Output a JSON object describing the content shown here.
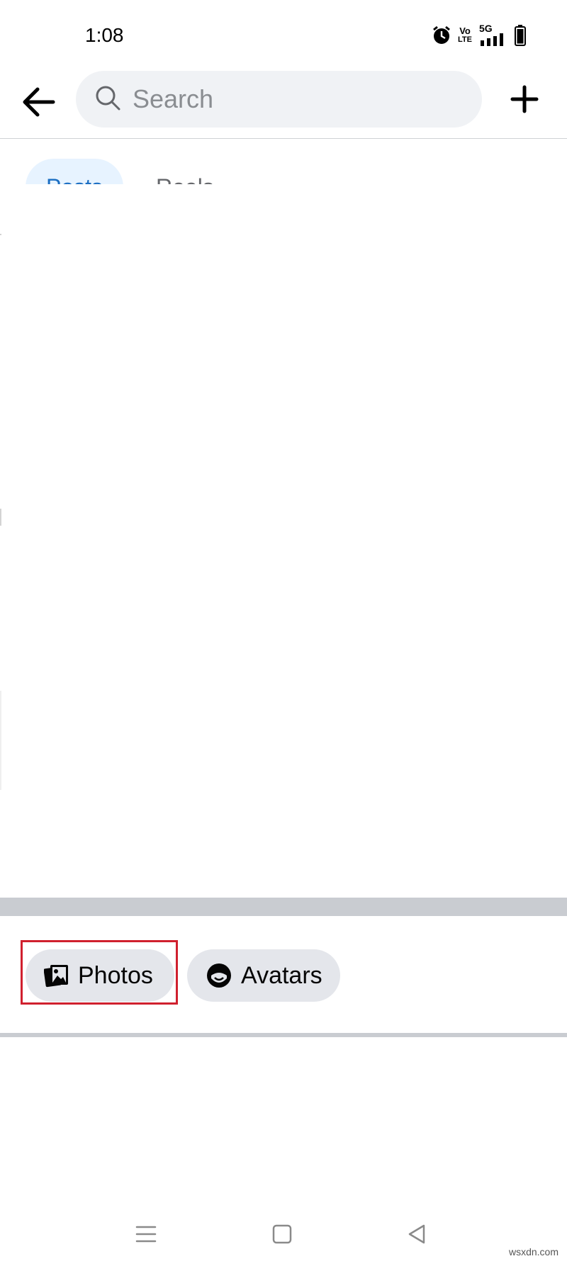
{
  "status_bar": {
    "time": "1:08",
    "network_label": "5G",
    "volte_top": "Vo",
    "volte_bottom": "LTE"
  },
  "top_bar": {
    "search_placeholder": "Search"
  },
  "tabs": [
    {
      "label": "Posts",
      "active": true
    },
    {
      "label": "Reels",
      "active": false
    }
  ],
  "chips": [
    {
      "label": "Photos",
      "icon": "photos-icon",
      "highlighted": true
    },
    {
      "label": "Avatars",
      "icon": "avatar-icon",
      "highlighted": false
    }
  ],
  "colors": {
    "accent": "#1b6ec2",
    "active_tab_bg": "#e7f3ff",
    "chip_bg": "#e4e6eb",
    "highlight": "#d0202e",
    "divider": "#c9ccd1"
  },
  "watermark": "wsxdn.com"
}
